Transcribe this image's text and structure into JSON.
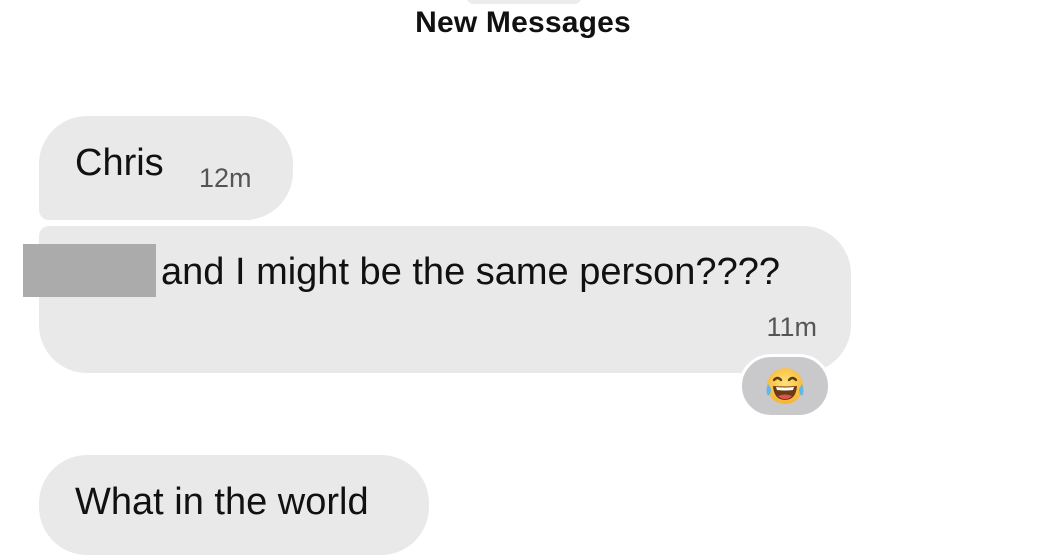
{
  "header": {
    "title": "New Messages"
  },
  "messages": [
    {
      "text": "Chris",
      "time": "12m"
    },
    {
      "text": "and I might be the same person????",
      "time": "11m",
      "redacted_prefix": true,
      "reaction": {
        "icon": "tears-of-joy-emoji-icon"
      }
    },
    {
      "text": "What in the world"
    }
  ],
  "colors": {
    "bubble": "#e9e9ea",
    "reaction_bg": "#c9c9cb",
    "redaction": "#ababab",
    "text": "#111111",
    "timestamp": "#555555"
  }
}
